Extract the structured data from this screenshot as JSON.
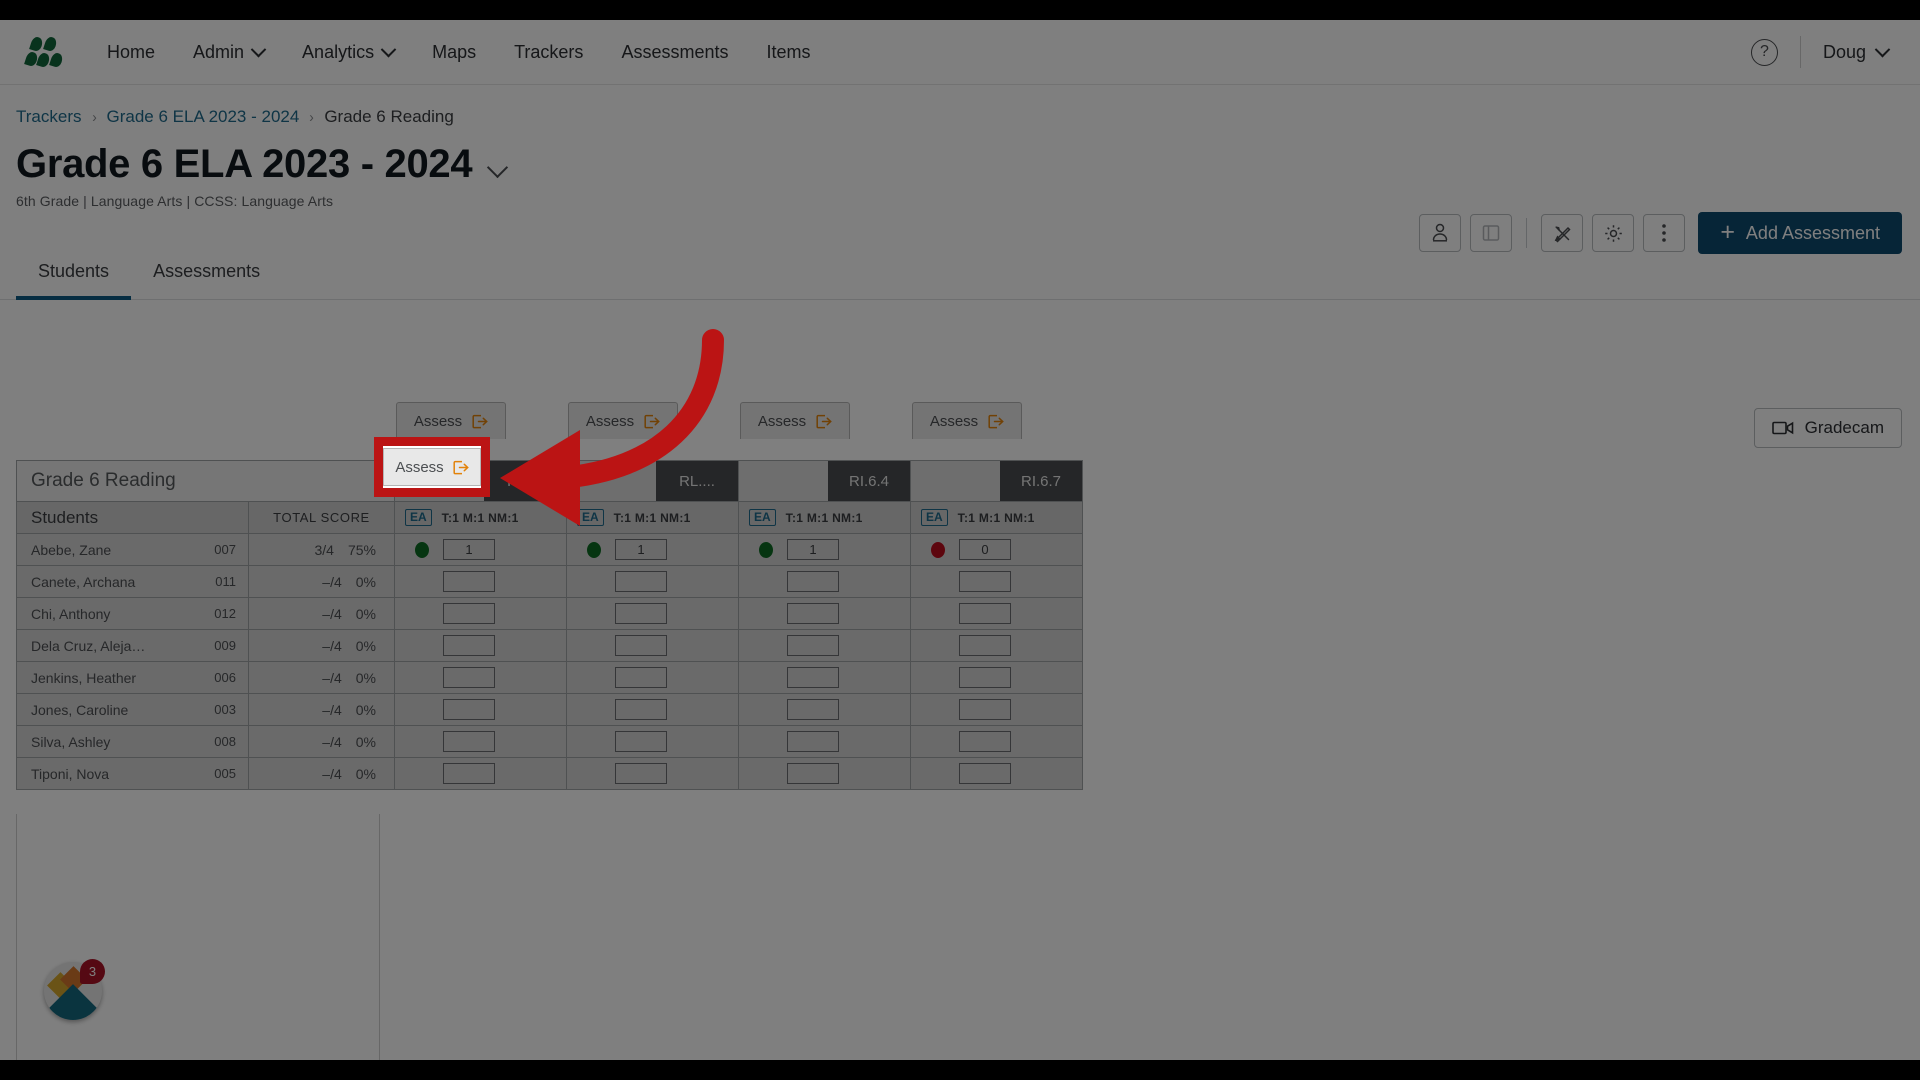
{
  "topnav": {
    "logo_name": "illuminate-logo",
    "items": [
      {
        "label": "Home",
        "has_caret": false
      },
      {
        "label": "Admin",
        "has_caret": true
      },
      {
        "label": "Analytics",
        "has_caret": true
      },
      {
        "label": "Maps",
        "has_caret": false
      },
      {
        "label": "Trackers",
        "has_caret": false
      },
      {
        "label": "Assessments",
        "has_caret": false
      },
      {
        "label": "Items",
        "has_caret": false
      }
    ],
    "help_icon": "question-mark-circle-icon",
    "user": "Doug"
  },
  "breadcrumb": {
    "items": [
      "Trackers",
      "Grade 6 ELA 2023 - 2024",
      "Grade 6 Reading"
    ],
    "separator": "›"
  },
  "header": {
    "title": "Grade 6 ELA 2023 - 2024",
    "subtitle": "6th Grade  |  Language Arts  |  CCSS: Language Arts",
    "title_caret": "chevron-down-icon"
  },
  "toolbar": {
    "buttons": [
      {
        "name": "student-profile-icon",
        "label": ""
      },
      {
        "name": "panel-toggle-icon",
        "label": ""
      },
      {
        "name": "edit-tools-icon",
        "label": ""
      },
      {
        "name": "settings-gear-icon",
        "label": ""
      },
      {
        "name": "more-options-icon",
        "label": ""
      }
    ],
    "add_assessment_label": "Add Assessment",
    "add_assessment_plus": "+",
    "accent_color": "#0d4a6e"
  },
  "tabs": [
    {
      "label": "Students",
      "active": true
    },
    {
      "label": "Assessments",
      "active": false
    }
  ],
  "gradecam": {
    "label": "Gradecam",
    "icon": "video-camera-icon"
  },
  "grid": {
    "tracker_title": "Grade 6 Reading",
    "col_students": "Students",
    "col_total_score": "TOTAL SCORE",
    "assess_label": "Assess",
    "assess_icon": "external-launch-icon",
    "columns": [
      {
        "standard": "RL....",
        "ea_badge": "EA",
        "meta": "T:1  M:1  NM:1"
      },
      {
        "standard": "RL....",
        "ea_badge": "EA",
        "meta": "T:1  M:1  NM:1"
      },
      {
        "standard": "RI.6.4",
        "ea_badge": "EA",
        "meta": "T:1  M:1  NM:1"
      },
      {
        "standard": "RI.6.7",
        "ea_badge": "EA",
        "meta": "T:1  M:1  NM:1"
      }
    ],
    "students": [
      {
        "name": "Abebe, Zane",
        "id": "007",
        "total": "3/4",
        "percent": "75%",
        "scores": [
          {
            "dot": "green",
            "value": "1"
          },
          {
            "dot": "green",
            "value": "1"
          },
          {
            "dot": "green",
            "value": "1"
          },
          {
            "dot": "red",
            "value": "0"
          }
        ]
      },
      {
        "name": "Canete, Archana",
        "id": "011",
        "total": "–/4",
        "percent": "0%",
        "scores": [
          {
            "dot": "none",
            "value": ""
          },
          {
            "dot": "none",
            "value": ""
          },
          {
            "dot": "none",
            "value": ""
          },
          {
            "dot": "none",
            "value": ""
          }
        ]
      },
      {
        "name": "Chi, Anthony",
        "id": "012",
        "total": "–/4",
        "percent": "0%",
        "scores": [
          {
            "dot": "none",
            "value": ""
          },
          {
            "dot": "none",
            "value": ""
          },
          {
            "dot": "none",
            "value": ""
          },
          {
            "dot": "none",
            "value": ""
          }
        ]
      },
      {
        "name": "Dela Cruz, Aleja…",
        "id": "009",
        "total": "–/4",
        "percent": "0%",
        "scores": [
          {
            "dot": "none",
            "value": ""
          },
          {
            "dot": "none",
            "value": ""
          },
          {
            "dot": "none",
            "value": ""
          },
          {
            "dot": "none",
            "value": ""
          }
        ]
      },
      {
        "name": "Jenkins, Heather",
        "id": "006",
        "total": "–/4",
        "percent": "0%",
        "scores": [
          {
            "dot": "none",
            "value": ""
          },
          {
            "dot": "none",
            "value": ""
          },
          {
            "dot": "none",
            "value": ""
          },
          {
            "dot": "none",
            "value": ""
          }
        ]
      },
      {
        "name": "Jones, Caroline",
        "id": "003",
        "total": "–/4",
        "percent": "0%",
        "scores": [
          {
            "dot": "none",
            "value": ""
          },
          {
            "dot": "none",
            "value": ""
          },
          {
            "dot": "none",
            "value": ""
          },
          {
            "dot": "none",
            "value": ""
          }
        ]
      },
      {
        "name": "Silva, Ashley",
        "id": "008",
        "total": "–/4",
        "percent": "0%",
        "scores": [
          {
            "dot": "none",
            "value": ""
          },
          {
            "dot": "none",
            "value": ""
          },
          {
            "dot": "none",
            "value": ""
          },
          {
            "dot": "none",
            "value": ""
          }
        ]
      },
      {
        "name": "Tiponi, Nova",
        "id": "005",
        "total": "–/4",
        "percent": "0%",
        "scores": [
          {
            "dot": "none",
            "value": ""
          },
          {
            "dot": "none",
            "value": ""
          },
          {
            "dot": "none",
            "value": ""
          },
          {
            "dot": "none",
            "value": ""
          }
        ]
      }
    ]
  },
  "launcher": {
    "name": "help-launcher-widget",
    "badge_count": "3",
    "badge_color": "#aa1326"
  },
  "annotation": {
    "highlight_target": "Assess",
    "highlight_color": "#bb1414",
    "arrow": "curved-arrow-pointing-left"
  }
}
